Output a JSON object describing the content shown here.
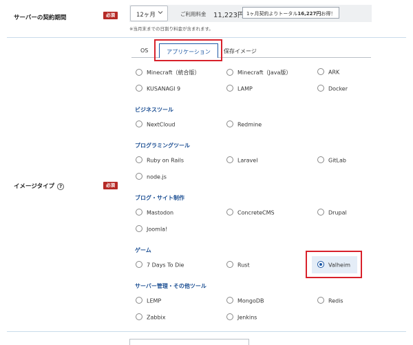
{
  "contract": {
    "label": "サーバーの契約期間",
    "badge": "必須",
    "select_value": "12ヶ月",
    "fee_label": "ご利用料金",
    "fee_value": "11,223円",
    "deal_prefix": "1ヶ月契約よりトータル",
    "deal_amount": "16,227円",
    "deal_suffix": "お得！",
    "note": "※当月末までの日割り料金が含まれます。"
  },
  "image_type": {
    "label": "イメージタイプ",
    "badge": "必須",
    "help": "?",
    "tabs": [
      "OS",
      "アプリケーション",
      "保存イメージ"
    ],
    "apps_top": [
      "Minecraft（統合版）",
      "Minecraft（Java版）",
      "ARK",
      "KUSANAGI 9",
      "LAMP",
      "Docker"
    ],
    "categories": [
      {
        "title": "ビジネスツール",
        "items": [
          "NextCloud",
          "Redmine"
        ]
      },
      {
        "title": "プログラミングツール",
        "items": [
          "Ruby on Rails",
          "Laravel",
          "GitLab",
          "node.js"
        ]
      },
      {
        "title": "ブログ・サイト制作",
        "items": [
          "Mastodon",
          "ConcreteCMS",
          "Drupal",
          "Joomla!"
        ]
      },
      {
        "title": "ゲーム",
        "items": [
          "7 Days To Die",
          "Rust",
          "Valheim"
        ]
      },
      {
        "title": "サーバー管理・その他ツール",
        "items": [
          "LEMP",
          "MongoDB",
          "Redis",
          "Zabbix",
          "Jenkins"
        ]
      }
    ],
    "selected": "Valheim"
  },
  "colors": {
    "accent": "#1c58a5",
    "badge": "#b52a26",
    "highlight": "#d8202a"
  }
}
